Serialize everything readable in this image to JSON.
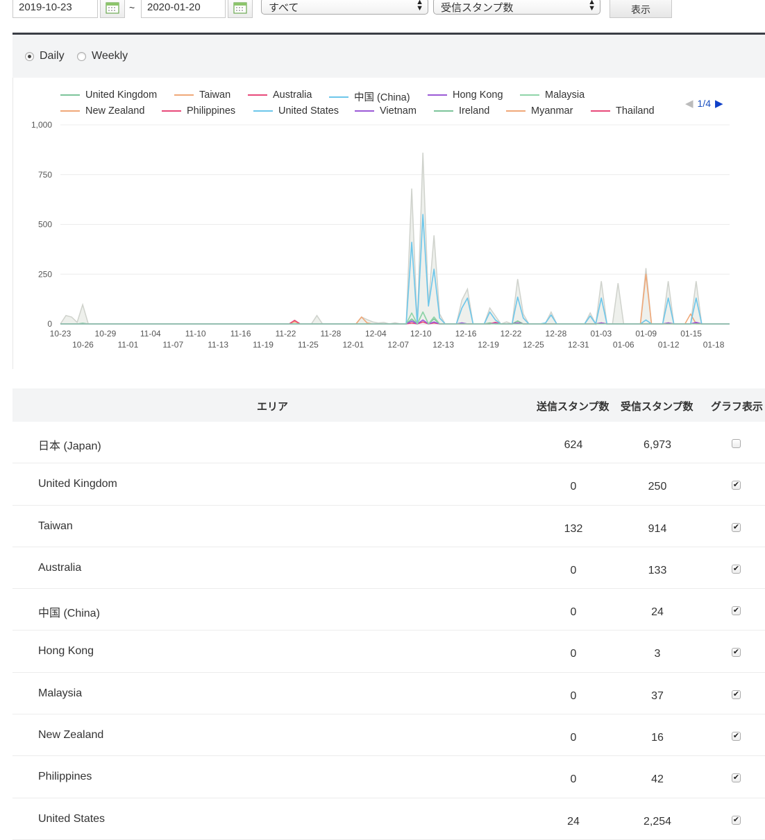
{
  "filters": {
    "start_date": "2019-10-23",
    "separator": "~",
    "end_date": "2020-01-20",
    "category_select": "すべて",
    "metric_select": "受信スタンプ数",
    "show_button": "表示"
  },
  "period": {
    "options": [
      "Daily",
      "Weekly"
    ],
    "selected": "Daily"
  },
  "legend_pager": "1/4",
  "chart_data": {
    "type": "area",
    "x_tick_labels_top": [
      "10-23",
      "10-29",
      "11-04",
      "11-10",
      "11-16",
      "11-22",
      "11-28",
      "12-04",
      "12-10",
      "12-16",
      "12-22",
      "12-28",
      "01-03",
      "01-09",
      "01-15"
    ],
    "x_tick_labels_bottom": [
      "10-26",
      "11-01",
      "11-07",
      "11-13",
      "11-19",
      "11-25",
      "12-01",
      "12-07",
      "12-13",
      "12-19",
      "12-25",
      "12-31",
      "01-06",
      "01-12",
      "01-18"
    ],
    "y_ticks": [
      "0",
      "250",
      "500",
      "750",
      "1,000"
    ],
    "ylim": [
      0,
      1000
    ],
    "grid": true,
    "legend_placement": "top",
    "total": {
      "color": "#cfd2cc",
      "values": [
        0,
        42,
        35,
        8,
        97,
        0,
        0,
        0,
        0,
        0,
        0,
        0,
        0,
        0,
        0,
        0,
        0,
        0,
        0,
        0,
        0,
        0,
        0,
        0,
        0,
        0,
        0,
        0,
        0,
        0,
        0,
        0,
        0,
        0,
        0,
        0,
        0,
        0,
        0,
        0,
        0,
        0,
        18,
        0,
        0,
        0,
        42,
        0,
        0,
        0,
        0,
        0,
        0,
        0,
        35,
        22,
        10,
        5,
        8,
        0,
        6,
        0,
        0,
        680,
        0,
        860,
        100,
        445,
        50,
        0,
        0,
        0,
        120,
        175,
        0,
        0,
        0,
        80,
        40,
        0,
        10,
        0,
        225,
        50,
        0,
        0,
        0,
        5,
        60,
        0,
        0,
        0,
        0,
        0,
        0,
        55,
        0,
        215,
        0,
        0,
        205,
        0,
        0,
        0,
        0,
        280,
        0,
        0,
        0,
        215,
        0,
        0,
        0,
        0,
        215,
        0,
        0,
        0,
        0,
        0,
        0
      ]
    },
    "series": [
      {
        "name": "United Kingdom",
        "color": "#7cc49a",
        "values": [
          0,
          0,
          0,
          0,
          3,
          0,
          0,
          0,
          0,
          0,
          0,
          0,
          0,
          0,
          0,
          0,
          0,
          0,
          0,
          0,
          0,
          0,
          0,
          0,
          0,
          0,
          0,
          0,
          0,
          0,
          0,
          0,
          0,
          0,
          0,
          0,
          0,
          0,
          0,
          0,
          0,
          0,
          0,
          0,
          0,
          0,
          0,
          0,
          0,
          0,
          0,
          0,
          0,
          0,
          0,
          0,
          0,
          0,
          0,
          0,
          0,
          0,
          0,
          25,
          0,
          60,
          0,
          25,
          0,
          0,
          0,
          0,
          5,
          0,
          0,
          0,
          0,
          5,
          0,
          0,
          0,
          0,
          15,
          0,
          0,
          0,
          0,
          0,
          0,
          0,
          0,
          0,
          0,
          0,
          0,
          0,
          0,
          5,
          0,
          0,
          0,
          0,
          0,
          0,
          0,
          0,
          0,
          0,
          0,
          5,
          0,
          0,
          0,
          0,
          5,
          0,
          0,
          0,
          0,
          0,
          0
        ]
      },
      {
        "name": "Taiwan",
        "color": "#f0a878",
        "values": [
          0,
          0,
          0,
          0,
          0,
          0,
          0,
          0,
          0,
          0,
          0,
          0,
          0,
          0,
          0,
          0,
          0,
          0,
          0,
          0,
          0,
          0,
          0,
          0,
          0,
          0,
          0,
          0,
          0,
          0,
          0,
          0,
          0,
          0,
          0,
          0,
          0,
          0,
          0,
          0,
          0,
          0,
          12,
          0,
          0,
          0,
          0,
          0,
          0,
          0,
          0,
          0,
          0,
          0,
          35,
          5,
          0,
          0,
          0,
          0,
          0,
          0,
          0,
          5,
          0,
          10,
          0,
          5,
          0,
          0,
          0,
          0,
          0,
          0,
          0,
          0,
          0,
          0,
          5,
          0,
          0,
          0,
          5,
          0,
          0,
          0,
          0,
          0,
          0,
          0,
          0,
          0,
          0,
          0,
          0,
          0,
          0,
          5,
          0,
          0,
          0,
          0,
          0,
          0,
          0,
          250,
          0,
          0,
          0,
          5,
          0,
          0,
          0,
          50,
          0,
          0,
          0,
          0,
          0,
          0,
          0
        ]
      },
      {
        "name": "Australia",
        "color": "#e8497a",
        "values": [
          0,
          0,
          0,
          0,
          0,
          0,
          0,
          0,
          0,
          0,
          0,
          0,
          0,
          0,
          0,
          0,
          0,
          0,
          0,
          0,
          0,
          0,
          0,
          0,
          0,
          0,
          0,
          0,
          0,
          0,
          0,
          0,
          0,
          0,
          0,
          0,
          0,
          0,
          0,
          0,
          0,
          0,
          18,
          0,
          0,
          0,
          0,
          0,
          0,
          0,
          0,
          0,
          0,
          0,
          0,
          0,
          0,
          0,
          0,
          0,
          0,
          0,
          0,
          5,
          0,
          10,
          0,
          5,
          0,
          0,
          0,
          0,
          0,
          0,
          0,
          0,
          0,
          0,
          8,
          0,
          0,
          0,
          5,
          0,
          0,
          0,
          0,
          0,
          0,
          0,
          0,
          0,
          0,
          0,
          0,
          0,
          0,
          5,
          0,
          0,
          0,
          0,
          0,
          0,
          0,
          0,
          0,
          0,
          0,
          0,
          0,
          0,
          0,
          0,
          5,
          0,
          0,
          0,
          0,
          0,
          0
        ]
      },
      {
        "name": "中国 (China)",
        "color": "#6cc6ea",
        "values": [
          0,
          0,
          0,
          0,
          0,
          0,
          0,
          0,
          0,
          0,
          0,
          0,
          0,
          0,
          0,
          0,
          0,
          0,
          0,
          0,
          0,
          0,
          0,
          0,
          0,
          0,
          0,
          0,
          0,
          0,
          0,
          0,
          0,
          0,
          0,
          0,
          0,
          0,
          0,
          0,
          0,
          0,
          0,
          0,
          0,
          0,
          0,
          0,
          0,
          0,
          0,
          0,
          0,
          0,
          0,
          0,
          0,
          0,
          0,
          0,
          0,
          0,
          0,
          410,
          0,
          550,
          90,
          275,
          30,
          0,
          0,
          0,
          80,
          130,
          0,
          0,
          0,
          60,
          20,
          0,
          0,
          0,
          135,
          30,
          0,
          0,
          0,
          5,
          45,
          0,
          0,
          0,
          0,
          0,
          0,
          40,
          0,
          130,
          0,
          0,
          0,
          0,
          0,
          0,
          0,
          20,
          0,
          0,
          0,
          130,
          0,
          0,
          0,
          0,
          130,
          0,
          0,
          0,
          0,
          0,
          0
        ]
      },
      {
        "name": "Hong Kong",
        "color": "#9b59d6",
        "values": [
          0,
          0,
          0,
          0,
          0,
          0,
          0,
          0,
          0,
          0,
          0,
          0,
          0,
          0,
          0,
          0,
          0,
          0,
          0,
          0,
          0,
          0,
          0,
          0,
          0,
          0,
          0,
          0,
          0,
          0,
          0,
          0,
          0,
          0,
          0,
          0,
          0,
          0,
          0,
          0,
          0,
          0,
          0,
          0,
          0,
          0,
          0,
          0,
          0,
          0,
          0,
          0,
          0,
          0,
          0,
          0,
          0,
          0,
          0,
          0,
          0,
          0,
          0,
          15,
          0,
          20,
          0,
          10,
          0,
          0,
          0,
          0,
          5,
          0,
          0,
          0,
          0,
          0,
          3,
          0,
          0,
          0,
          5,
          0,
          0,
          0,
          0,
          0,
          0,
          0,
          0,
          0,
          0,
          0,
          0,
          0,
          0,
          5,
          0,
          0,
          0,
          0,
          0,
          0,
          0,
          0,
          0,
          0,
          0,
          5,
          0,
          0,
          0,
          0,
          8,
          0,
          0,
          0,
          0,
          0,
          0
        ]
      },
      {
        "name": "Malaysia",
        "color": "#8fd4a8",
        "values": [
          0,
          0,
          0,
          0,
          0,
          0,
          0,
          0,
          0,
          0,
          0,
          0,
          0,
          0,
          0,
          0,
          0,
          0,
          0,
          0,
          0,
          0,
          0,
          0,
          0,
          0,
          0,
          0,
          0,
          0,
          0,
          0,
          0,
          0,
          0,
          0,
          0,
          0,
          0,
          0,
          0,
          0,
          0,
          0,
          0,
          0,
          0,
          0,
          0,
          0,
          0,
          0,
          0,
          0,
          0,
          0,
          0,
          0,
          0,
          0,
          0,
          0,
          0,
          55,
          0,
          60,
          0,
          35,
          0,
          0,
          0,
          0,
          0,
          0,
          0,
          0,
          0,
          0,
          0,
          0,
          0,
          0,
          0,
          0,
          0,
          0,
          0,
          0,
          0,
          0,
          0,
          0,
          0,
          0,
          0,
          0,
          0,
          0,
          0,
          0,
          0,
          0,
          0,
          0,
          0,
          0,
          0,
          0,
          0,
          0,
          0,
          0,
          0,
          0,
          0,
          0,
          0,
          0,
          0,
          0,
          0
        ]
      }
    ]
  },
  "legend": [
    {
      "name": "United Kingdom",
      "color": "#7cc49a"
    },
    {
      "name": "Taiwan",
      "color": "#f0a878"
    },
    {
      "name": "Australia",
      "color": "#e8497a"
    },
    {
      "name": "中国 (China)",
      "color": "#6cc6ea"
    },
    {
      "name": "Hong Kong",
      "color": "#9b59d6"
    },
    {
      "name": "Malaysia",
      "color": "#8fd4a8"
    },
    {
      "name": "New Zealand",
      "color": "#f0a878"
    },
    {
      "name": "Philippines",
      "color": "#e8497a"
    },
    {
      "name": "United States",
      "color": "#6cc6ea"
    },
    {
      "name": "Vietnam",
      "color": "#9b59d6"
    },
    {
      "name": "Ireland",
      "color": "#7cc49a"
    },
    {
      "name": "Myanmar",
      "color": "#f0a878"
    },
    {
      "name": "Thailand",
      "color": "#e8497a"
    }
  ],
  "table": {
    "headers": {
      "area": "エリア",
      "sent": "送信スタンプ数",
      "received": "受信スタンプ数",
      "graph": "グラフ表示"
    },
    "rows": [
      {
        "area": "日本 (Japan)",
        "sent": "624",
        "received": "6,973",
        "checked": false
      },
      {
        "area": "United Kingdom",
        "sent": "0",
        "received": "250",
        "checked": true
      },
      {
        "area": "Taiwan",
        "sent": "132",
        "received": "914",
        "checked": true
      },
      {
        "area": "Australia",
        "sent": "0",
        "received": "133",
        "checked": true
      },
      {
        "area": "中国 (China)",
        "sent": "0",
        "received": "24",
        "checked": true
      },
      {
        "area": "Hong Kong",
        "sent": "0",
        "received": "3",
        "checked": true
      },
      {
        "area": "Malaysia",
        "sent": "0",
        "received": "37",
        "checked": true
      },
      {
        "area": "New Zealand",
        "sent": "0",
        "received": "16",
        "checked": true
      },
      {
        "area": "Philippines",
        "sent": "0",
        "received": "42",
        "checked": true
      },
      {
        "area": "United States",
        "sent": "24",
        "received": "2,254",
        "checked": true
      }
    ]
  }
}
